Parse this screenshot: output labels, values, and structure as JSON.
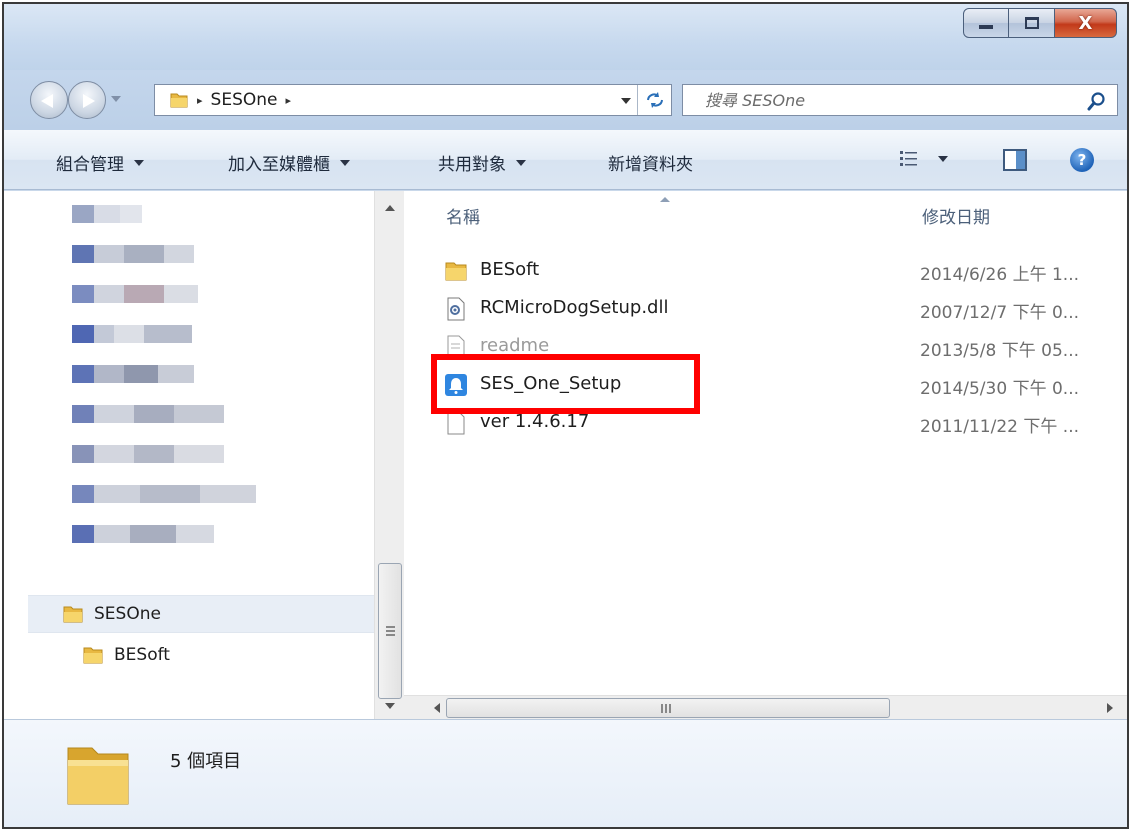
{
  "window": {
    "controls": {
      "close": "X"
    }
  },
  "address": {
    "current_folder": "SESOne",
    "separator": "▸",
    "search_placeholder": "搜尋 SESOne"
  },
  "toolbar": {
    "organize": "組合管理",
    "include_in_library": "加入至媒體櫃",
    "share_with": "共用對象",
    "new_folder": "新增資料夾"
  },
  "navigation": {
    "tree": [
      {
        "label": "SESOne",
        "icon": "folder-icon",
        "selected": true
      },
      {
        "label": "BESoft",
        "icon": "folder-icon",
        "selected": false
      }
    ]
  },
  "file_list": {
    "columns": {
      "name": "名稱",
      "date_modified": "修改日期"
    },
    "files": [
      {
        "name": "BESoft",
        "date": "2014/6/26 上午 1...",
        "icon": "folder-icon"
      },
      {
        "name": "RCMicroDogSetup.dll",
        "date": "2007/12/7 下午 0...",
        "icon": "dll-file-icon"
      },
      {
        "name": "readme",
        "date": "2013/5/8 下午 05...",
        "icon": "text-file-icon"
      },
      {
        "name": "SES_One_Setup",
        "date": "2014/5/30 下午 0...",
        "icon": "setup-app-icon",
        "highlighted": true
      },
      {
        "name": "ver 1.4.6.17",
        "date": "2011/11/22 下午 ...",
        "icon": "blank-file-icon"
      }
    ]
  },
  "details": {
    "item_count": "5 個項目"
  },
  "colors": {
    "highlight_border": "#ff0000",
    "window_frame": "#c9d8ea",
    "close_button": "#c2391a"
  }
}
